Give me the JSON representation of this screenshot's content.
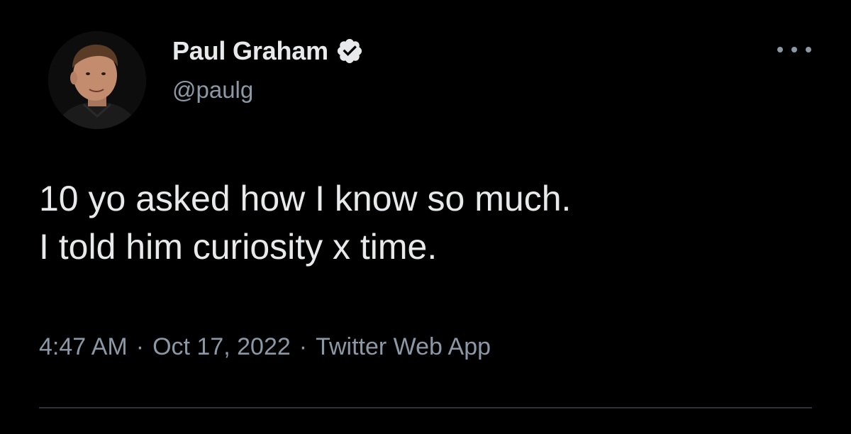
{
  "author": {
    "display_name": "Paul Graham",
    "handle": "@paulg",
    "verified": true,
    "avatar_icon": "person-avatar-icon"
  },
  "menu": {
    "icon": "more-horizontal-icon"
  },
  "tweet": {
    "lines": [
      "10 yo asked how I know so much.",
      "I told him curiosity x time."
    ]
  },
  "meta": {
    "time": "4:47 AM",
    "separator": "·",
    "date": "Oct 17, 2022",
    "source": "Twitter Web App"
  },
  "colors": {
    "background": "#000000",
    "primary_text": "#e7e9ea",
    "secondary_text": "#8b98a5",
    "divider": "#2f3336",
    "verified_badge": "#e7e9ea"
  }
}
